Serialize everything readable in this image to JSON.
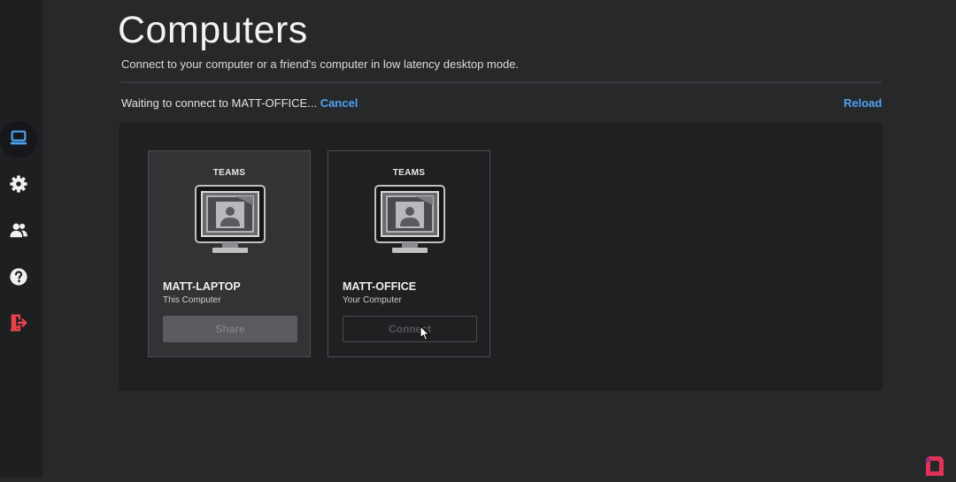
{
  "colors": {
    "accent": "#4ea1f0",
    "logout": "#e8424c",
    "background": "#27282a",
    "sidebar": "#1e1f21",
    "panel": "#1f2022"
  },
  "sidebar": {
    "items": [
      {
        "icon": "laptop-icon",
        "active": true
      },
      {
        "icon": "gear-icon",
        "active": false
      },
      {
        "icon": "users-icon",
        "active": false
      },
      {
        "icon": "help-icon",
        "active": false
      },
      {
        "icon": "logout-icon",
        "active": false
      }
    ]
  },
  "header": {
    "title": "Computers",
    "subtitle": "Connect to your computer or a friend's computer in low latency desktop mode."
  },
  "status": {
    "text": "Waiting to connect to MATT-OFFICE...",
    "cancel_label": "Cancel",
    "reload_label": "Reload"
  },
  "computers": [
    {
      "tag": "TEAMS",
      "name": "MATT-LAPTOP",
      "subtitle": "This Computer",
      "button": "Share"
    },
    {
      "tag": "TEAMS",
      "name": "MATT-OFFICE",
      "subtitle": "Your Computer",
      "button": "Connect"
    }
  ]
}
